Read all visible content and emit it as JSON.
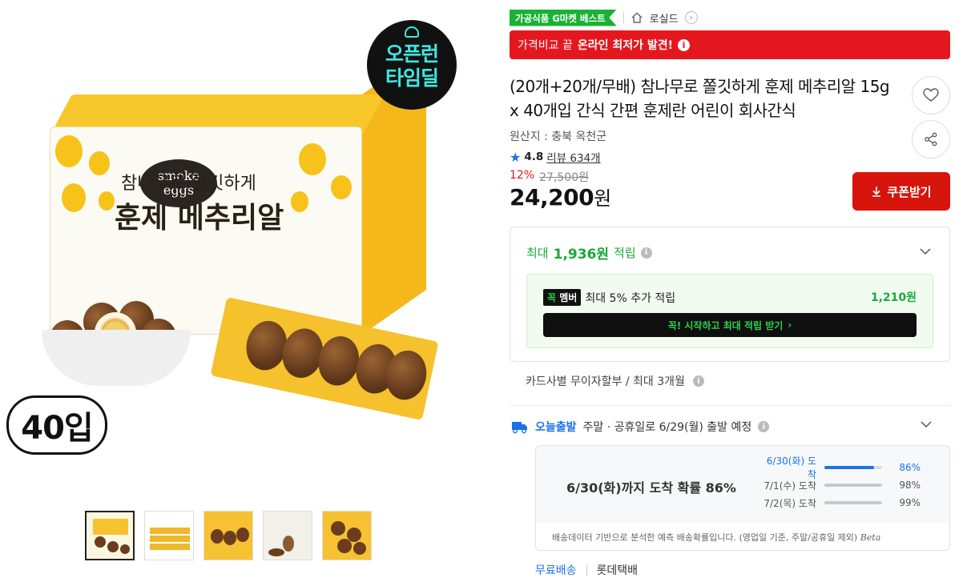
{
  "image": {
    "corner_badge_line1": "오픈런",
    "corner_badge_line2": "타임딜",
    "box_sub": "참나무로 쫄깃하게",
    "box_brand": "훈제 메추리알",
    "smoke_line1": "smoke",
    "smoke_line2": "eggs",
    "count_badge": "40입",
    "thumbnail_count": 5
  },
  "header": {
    "best_tag": "가공식품 G마켓 베스트",
    "brand": "로실드"
  },
  "promo": {
    "prefix": "가격비교 끝",
    "highlight": "온라인 최저가 발견!"
  },
  "product": {
    "title": "(20개+20개/무배) 참나무로 쫄깃하게 훈제 메추리알 15g x 40개입 간식 간편 훈제란 어린이 회사간식",
    "origin": "원산지 : 충북 옥천군",
    "rating": "4.8",
    "review_label": "리뷰 634개",
    "discount_pct": "12%",
    "original_price": "27,500원",
    "price_number": "24,200",
    "price_unit": "원",
    "coupon_label": "쿠폰받기"
  },
  "points": {
    "prefix": "최대",
    "amount": "1,936원",
    "suffix": "적립",
    "member_logo_a": "꼭",
    "member_logo_b": "멤버",
    "member_text": "최대 5% 추가 적립",
    "member_amount": "1,210원",
    "member_cta": "꼭! 시작하고 최대 적립 받기",
    "member_cta_arrow": "›"
  },
  "installment": "카드사별 무이자할부 / 최대 3개월",
  "shipping": {
    "label": "오늘출발",
    "text": "주말 · 공휴일로 6/29(월) 출발 예정",
    "main": "6/30(화)까지 도착 확률 86%",
    "items": [
      {
        "date": "6/30(화) 도착",
        "pct": "86%",
        "value": 0.86
      },
      {
        "date": "7/1(수) 도착",
        "pct": "98%",
        "value": 0.98
      },
      {
        "date": "7/2(목) 도착",
        "pct": "99%",
        "value": 0.99
      }
    ],
    "note": "배송데이터 기반으로 분석한 예측 배송확률입니다. (영업일 기준, 주말/공휴일 제외)",
    "beta": "Beta",
    "free": "무료배송",
    "courier": "롯데택배"
  },
  "colors": {
    "accent_red": "#e5171e",
    "green": "#19a93a",
    "blue": "#1a73e8"
  }
}
